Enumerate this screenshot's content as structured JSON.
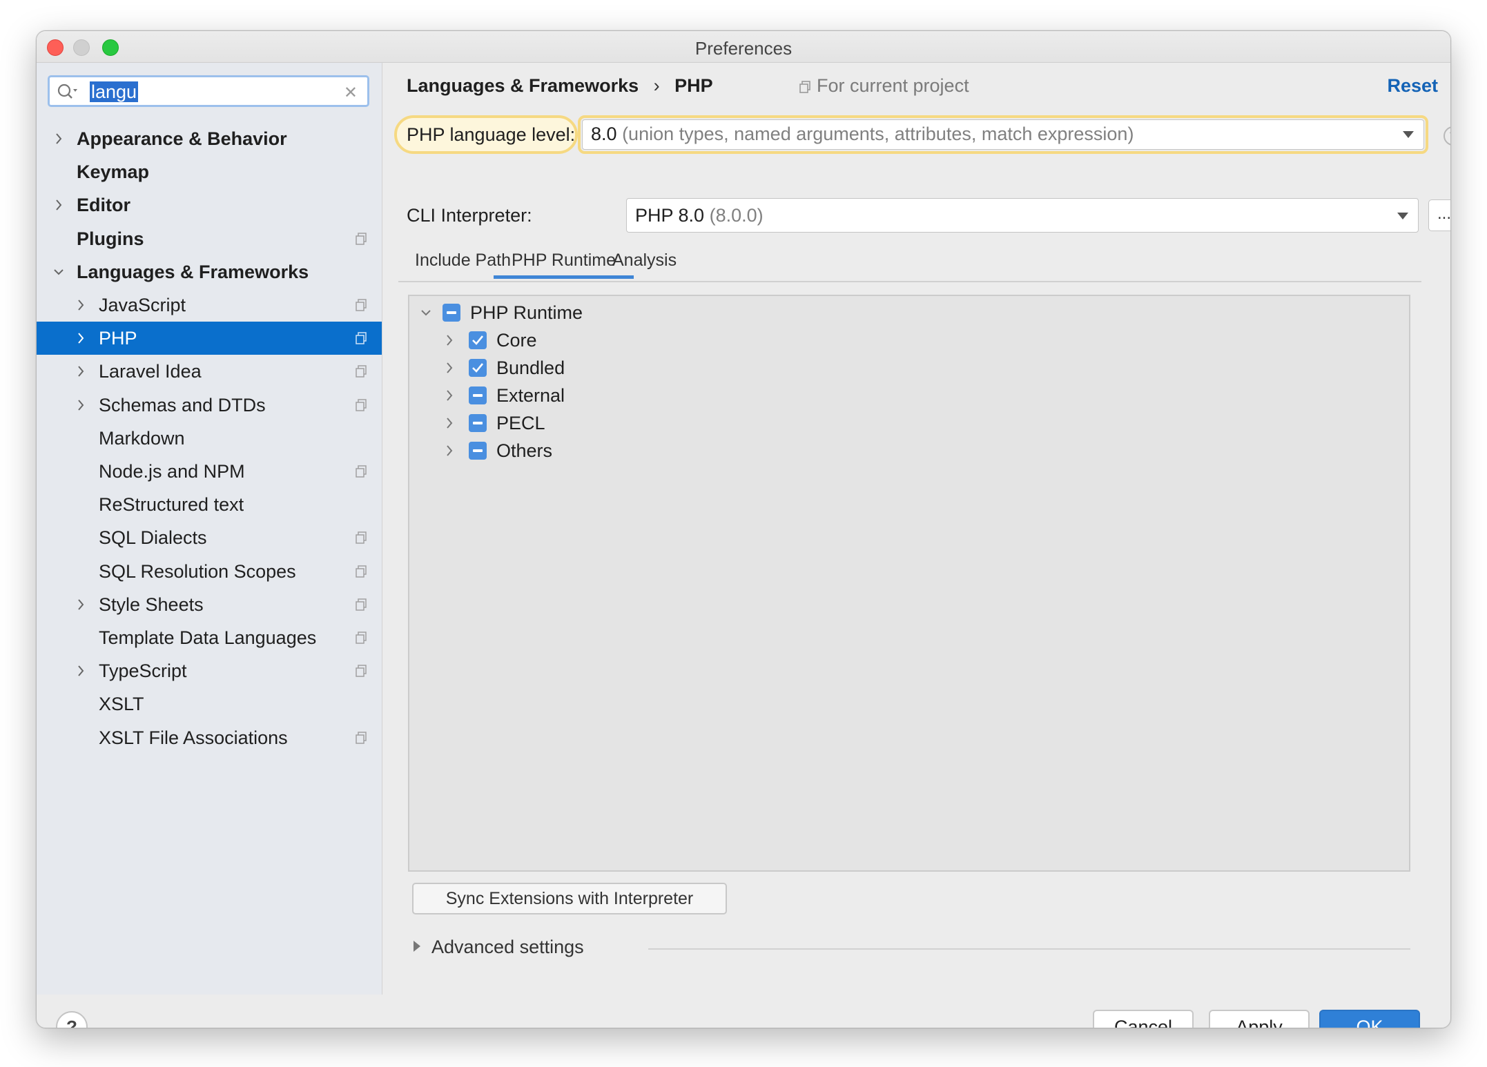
{
  "window": {
    "title": "Preferences"
  },
  "search": {
    "value": "langu"
  },
  "sidebar": {
    "items": [
      {
        "label": "Appearance & Behavior"
      },
      {
        "label": "Keymap"
      },
      {
        "label": "Editor"
      },
      {
        "label": "Plugins"
      },
      {
        "label": "Languages & Frameworks"
      },
      {
        "label": "JavaScript"
      },
      {
        "label": "PHP"
      },
      {
        "label": "Laravel Idea"
      },
      {
        "label": "Schemas and DTDs"
      },
      {
        "label": "Markdown"
      },
      {
        "label": "Node.js and NPM"
      },
      {
        "label": "ReStructured text"
      },
      {
        "label": "SQL Dialects"
      },
      {
        "label": "SQL Resolution Scopes"
      },
      {
        "label": "Style Sheets"
      },
      {
        "label": "Template Data Languages"
      },
      {
        "label": "TypeScript"
      },
      {
        "label": "XSLT"
      },
      {
        "label": "XSLT File Associations"
      }
    ]
  },
  "header": {
    "crumb1": "Languages & Frameworks",
    "crumb_sep": "›",
    "crumb2": "PHP",
    "scope": "For current project",
    "reset": "Reset"
  },
  "php": {
    "language_level_label": "PHP language level:",
    "language_level_value": "8.0",
    "language_level_desc": "(union types, named arguments, attributes, match expression)",
    "cli_label": "CLI Interpreter:",
    "cli_value": "PHP 8.0",
    "cli_version": "(8.0.0)",
    "ellipsis": "..."
  },
  "tabs": [
    {
      "label": "Include Path"
    },
    {
      "label": "PHP Runtime"
    },
    {
      "label": "Analysis"
    }
  ],
  "runtime": {
    "root": "PHP Runtime",
    "items": [
      {
        "label": "Core",
        "state": "checked"
      },
      {
        "label": "Bundled",
        "state": "checked"
      },
      {
        "label": "External",
        "state": "partial"
      },
      {
        "label": "PECL",
        "state": "partial"
      },
      {
        "label": "Others",
        "state": "partial"
      }
    ]
  },
  "sync_button": "Sync Extensions with Interpreter",
  "advanced": "Advanced settings",
  "footer": {
    "help": "?",
    "cancel": "Cancel",
    "apply": "Apply",
    "ok": "OK"
  },
  "colors": {
    "accent": "#0a6fcc",
    "highlight": "#f6d982",
    "checkbox": "#4a8fe0"
  }
}
